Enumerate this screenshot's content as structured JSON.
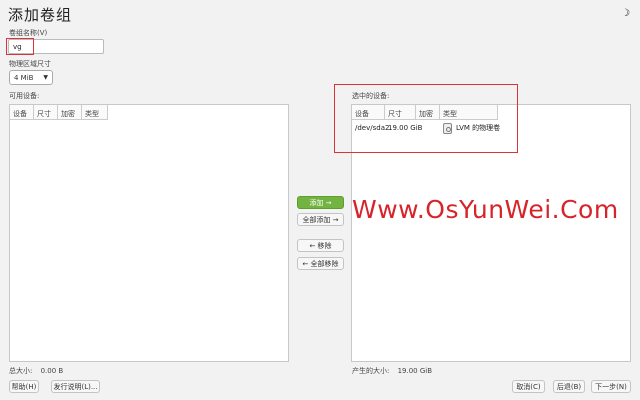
{
  "window": {
    "title": "添加卷组"
  },
  "volume_name": {
    "label": "卷组名称(V)",
    "value": "vg"
  },
  "extent_size": {
    "label": "物理区域尺寸",
    "value": "4 MiB"
  },
  "available": {
    "label": "可用设备:",
    "columns": [
      "设备",
      "尺寸",
      "加密",
      "类型"
    ],
    "total_label": "总大小:",
    "total_value": "0.00 B"
  },
  "selected": {
    "label": "选中的设备:",
    "columns": [
      "设备",
      "尺寸",
      "加密",
      "类型"
    ],
    "rows": [
      {
        "device": "/dev/sda2",
        "size": "19.00 GiB",
        "encrypted": "",
        "type": "LVM 的物理卷"
      }
    ],
    "result_label": "产生的大小:",
    "result_value": "19.00 GiB"
  },
  "transfer": {
    "add": "添加 →",
    "add_all": "全部添加 →",
    "remove": "← 移除",
    "remove_all": "← 全部移除"
  },
  "footer": {
    "help": "帮助(H)",
    "release_notes": "发行说明(L)...",
    "cancel": "取消(C)",
    "back": "后退(B)",
    "next": "下一步(N)"
  },
  "watermark": "Www.OsYunWei.Com",
  "colors": {
    "accent_green": "#72b342",
    "highlight_red": "#d9343a",
    "watermark_red": "#d7242a"
  },
  "icons": {
    "theme_toggle": "moon-icon",
    "device_type": "hard-disk-icon"
  }
}
